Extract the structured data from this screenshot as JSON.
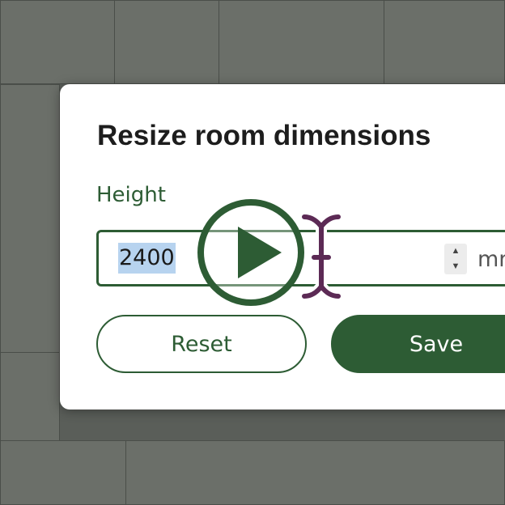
{
  "dialog": {
    "title": "Resize room dimensions",
    "field_label": "Height",
    "height_value": "2400",
    "unit": "mm",
    "reset_label": "Reset",
    "save_label": "Save"
  },
  "overlay": {
    "play_icon": "play-icon",
    "cursor_icon": "text-cursor-icon"
  },
  "colors": {
    "accent": "#2d5c34",
    "selection": "#b7d3ef",
    "cursor": "#5c2a55",
    "backdrop": "#5a5e59"
  }
}
